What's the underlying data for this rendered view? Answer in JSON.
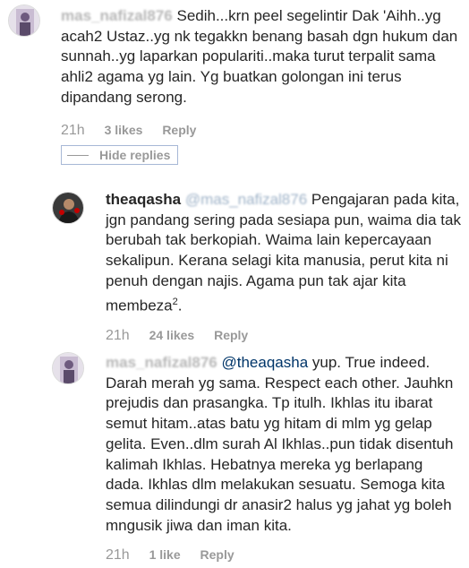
{
  "comments": [
    {
      "username": "mas_nafizal876",
      "text": "Sedih...krn peel segelintir Dak 'Aihh..yg acah2 Ustaz..yg nk tegakkn benang basah dgn hukum dan sunnah..yg laparkan populariti..maka turut terpalit sama ahli2 agama yg lain. Yg buatkan golongan ini terus dipandang serong.",
      "time": "21h",
      "likes": "3 likes",
      "reply": "Reply"
    }
  ],
  "hide_replies": "Hide replies",
  "replies": [
    {
      "username": "theaqasha",
      "mention": "@mas_nafizal876",
      "text": "Pengajaran pada kita, jgn pandang sering pada sesiapa pun, waima dia tak berubah tak berkopiah. Waima lain kepercayaan sekalipun. Kerana selagi kita manusia, perut kita ni penuh dengan najis. Agama pun tak ajar kita membeza",
      "superscript": "2",
      "text_end": ".",
      "time": "21h",
      "likes": "24 likes",
      "reply": "Reply"
    },
    {
      "username": "mas_nafizal876",
      "mention": "@theaqasha",
      "text": "yup. True indeed. Darah merah yg sama. Respect each other. Jauhkn prejudis dan prasangka. Tp itulh. Ikhlas itu ibarat semut hitam..atas batu yg hitam di mlm yg gelap gelita. Even..dlm surah Al Ikhlas..pun tidak disentuh kalimah Ikhlas. Hebatnya mereka yg berlapang dada. Ikhlas dlm melakukan sesuatu. Semoga kita semua dilindungi dr anasir2 halus yg jahat yg boleh mngusik jiwa dan iman kita.",
      "time": "21h",
      "likes": "1 like",
      "reply": "Reply"
    }
  ]
}
